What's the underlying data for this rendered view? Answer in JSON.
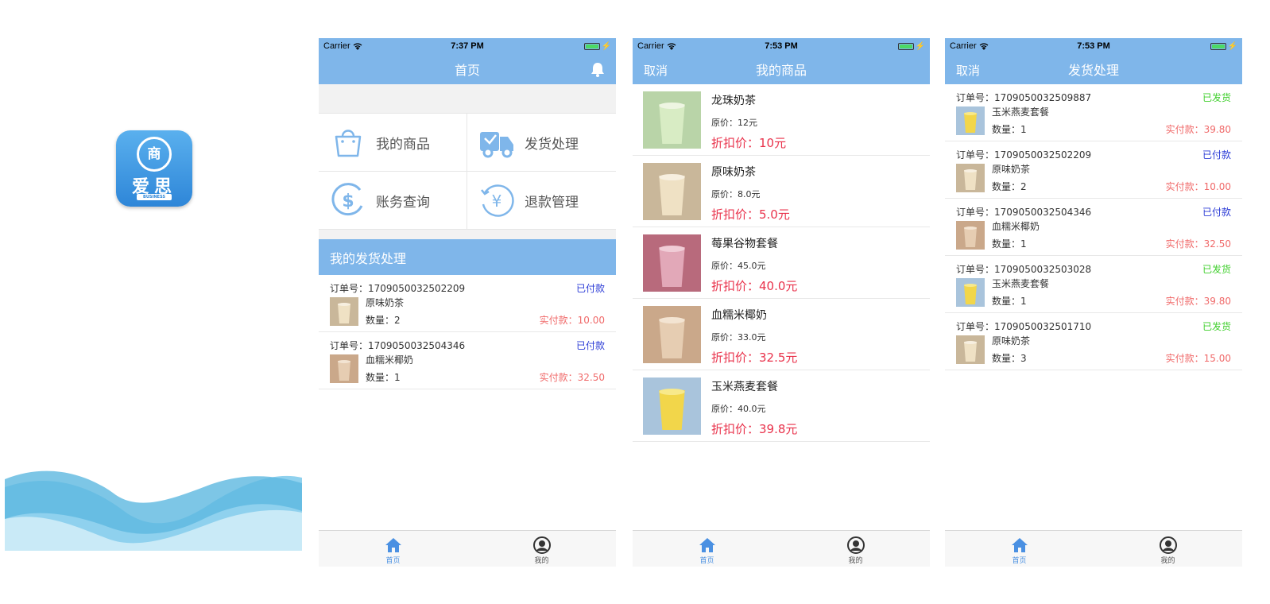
{
  "intro": {
    "icon_char": "商",
    "brand_name": "爱思",
    "brand_sub": "BUSINESS"
  },
  "statusbar": {
    "carrier": "Carrier",
    "times": [
      "7:37 PM",
      "7:53 PM",
      "7:53 PM"
    ]
  },
  "tabbar": {
    "home": "首页",
    "mine": "我的"
  },
  "home": {
    "title": "首页",
    "grid": [
      {
        "label": "我的商品",
        "icon": "bag-icon"
      },
      {
        "label": "发货处理",
        "icon": "truck-icon"
      },
      {
        "label": "账务查询",
        "icon": "dollar-icon"
      },
      {
        "label": "退款管理",
        "icon": "yen-icon"
      }
    ],
    "section_title": "我的发货处理",
    "orders": [
      {
        "order_label": "订单号：",
        "order_no": "1709050032502209",
        "status": "已付款",
        "status_type": "paid",
        "product": "原味奶茶",
        "qty_label": "数量：",
        "qty": "2",
        "paid_label": "实付款：",
        "paid": "10.00",
        "thumb": "beige"
      },
      {
        "order_label": "订单号：",
        "order_no": "1709050032504346",
        "status": "已付款",
        "status_type": "paid",
        "product": "血糯米椰奶",
        "qty_label": "数量：",
        "qty": "1",
        "paid_label": "实付款：",
        "paid": "32.50",
        "thumb": "tan"
      }
    ]
  },
  "products": {
    "cancel": "取消",
    "title": "我的商品",
    "items": [
      {
        "name": "龙珠奶茶",
        "orig": "原价：12元",
        "disc": "折扣价：10元",
        "img": "green"
      },
      {
        "name": "原味奶茶",
        "orig": "原价：8.0元",
        "disc": "折扣价：5.0元",
        "img": "beige"
      },
      {
        "name": "莓果谷物套餐",
        "orig": "原价：45.0元",
        "disc": "折扣价：40.0元",
        "img": "pink"
      },
      {
        "name": "血糯米椰奶",
        "orig": "原价：33.0元",
        "disc": "折扣价：32.5元",
        "img": "tan"
      },
      {
        "name": "玉米燕麦套餐",
        "orig": "原价：40.0元",
        "disc": "折扣价：39.8元",
        "img": "yellow"
      }
    ]
  },
  "shipping": {
    "cancel": "取消",
    "title": "发货处理",
    "orders": [
      {
        "order_label": "订单号：",
        "order_no": "1709050032509887",
        "status": "已发货",
        "status_type": "shipped",
        "product": "玉米燕麦套餐",
        "qty_label": "数量：",
        "qty": "1",
        "paid_label": "实付款：",
        "paid": "39.80",
        "thumb": "yellow"
      },
      {
        "order_label": "订单号：",
        "order_no": "1709050032502209",
        "status": "已付款",
        "status_type": "paid",
        "product": "原味奶茶",
        "qty_label": "数量：",
        "qty": "2",
        "paid_label": "实付款：",
        "paid": "10.00",
        "thumb": "beige"
      },
      {
        "order_label": "订单号：",
        "order_no": "1709050032504346",
        "status": "已付款",
        "status_type": "paid",
        "product": "血糯米椰奶",
        "qty_label": "数量：",
        "qty": "1",
        "paid_label": "实付款：",
        "paid": "32.50",
        "thumb": "tan"
      },
      {
        "order_label": "订单号：",
        "order_no": "1709050032503028",
        "status": "已发货",
        "status_type": "shipped",
        "product": "玉米燕麦套餐",
        "qty_label": "数量：",
        "qty": "1",
        "paid_label": "实付款：",
        "paid": "39.80",
        "thumb": "yellow"
      },
      {
        "order_label": "订单号：",
        "order_no": "1709050032501710",
        "status": "已发货",
        "status_type": "shipped",
        "product": "原味奶茶",
        "qty_label": "数量：",
        "qty": "3",
        "paid_label": "实付款：",
        "paid": "15.00",
        "thumb": "beige"
      }
    ]
  },
  "colors": {
    "nav_blue": "#7fb6ea",
    "paid_blue": "#2b3bd6",
    "shipped_green": "#3ecf2b",
    "price_red": "#e9324b"
  }
}
